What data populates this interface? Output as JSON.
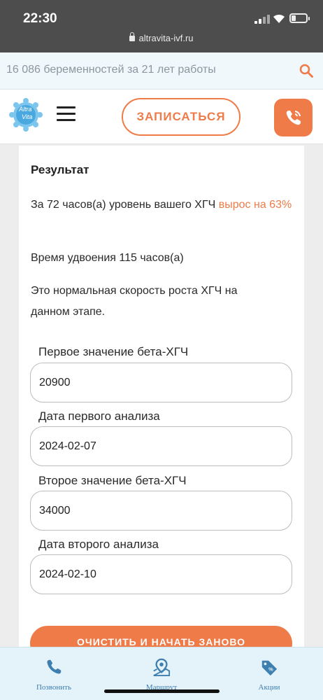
{
  "status": {
    "time": "22:30",
    "url": "altravita-ivf.ru"
  },
  "infobar": {
    "text": "16 086 беременностей за 21 лет работы"
  },
  "header": {
    "logo_text_1": "Altra",
    "logo_text_2": "Vita",
    "signup_label": "ЗАПИСАТЬСЯ"
  },
  "result": {
    "title": "Результат",
    "line1_pre": "За 72 часов(а) уровень вашего ХГЧ ",
    "line1_accent": "вырос на 63%",
    "line2": "Время удвоения 115 часов(а)",
    "line3": "Это нормальная скорость роста ХГЧ на данном этапе."
  },
  "form": {
    "first_value_label": "Первое значение бета-ХГЧ",
    "first_value": "20900",
    "first_date_label": "Дата первого анализа",
    "first_date": "2024-02-07",
    "second_value_label": "Второе значение бета-ХГЧ",
    "second_value": "34000",
    "second_date_label": "Дата второго анализа",
    "second_date": "2024-02-10",
    "clear_label": "ОЧИСТИТЬ И НАЧАТЬ ЗАНОВО"
  },
  "bottom_nav": {
    "call": "Позвонить",
    "route": "Маршрут",
    "promo": "Акции"
  },
  "colors": {
    "accent": "#ee7b48",
    "nav_blue": "#3e7fb0"
  }
}
